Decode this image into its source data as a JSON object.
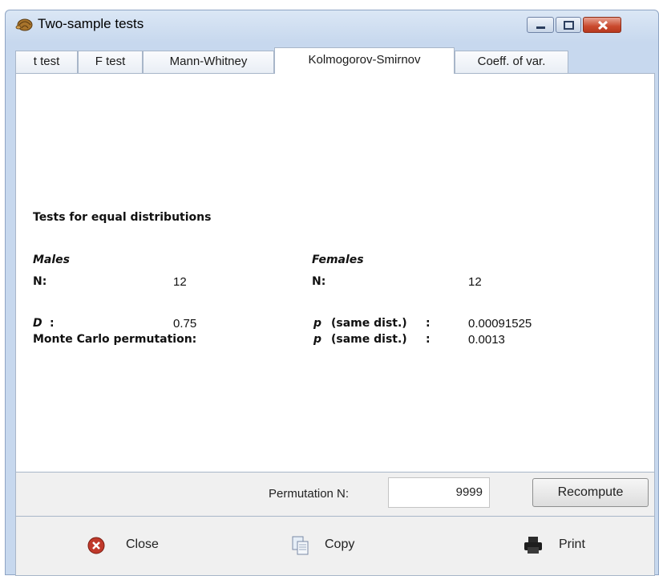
{
  "window": {
    "title": "Two-sample tests"
  },
  "tabs": [
    {
      "label": "t test",
      "active": false
    },
    {
      "label": "F test",
      "active": false
    },
    {
      "label": "Mann-Whitney",
      "active": false
    },
    {
      "label": "Kolmogorov-Smirnov",
      "active": true
    },
    {
      "label": "Coeff. of var.",
      "active": false
    }
  ],
  "results": {
    "heading": "Tests for equal distributions",
    "group1": {
      "name": "Males",
      "n_label": "N:",
      "n_value": "12"
    },
    "group2": {
      "name": "Females",
      "n_label": "N:",
      "n_value": "12"
    },
    "d_label": "D",
    "d_colon": ":",
    "d_value": "0.75",
    "p_label": "p",
    "p_suffix": "(same dist.)",
    "p_colon": ":",
    "p_value": "0.00091525",
    "mc_label": "Monte Carlo permutation:",
    "mc_p_label": "p",
    "mc_p_suffix": "(same dist.)",
    "mc_p_colon": ":",
    "mc_p_value": "0.0013"
  },
  "permutation": {
    "label": "Permutation N:",
    "value": "9999",
    "recompute_label": "Recompute"
  },
  "footer": {
    "close_label": "Close",
    "copy_label": "Copy",
    "print_label": "Print"
  },
  "colors": {
    "title_bar": "#c7d8ee",
    "close_button": "#c94a2e",
    "close_icon": "#c0392b"
  },
  "icons": {
    "app": "shell-icon",
    "close": "close-circle-icon",
    "copy": "copy-icon",
    "print": "printer-icon"
  }
}
